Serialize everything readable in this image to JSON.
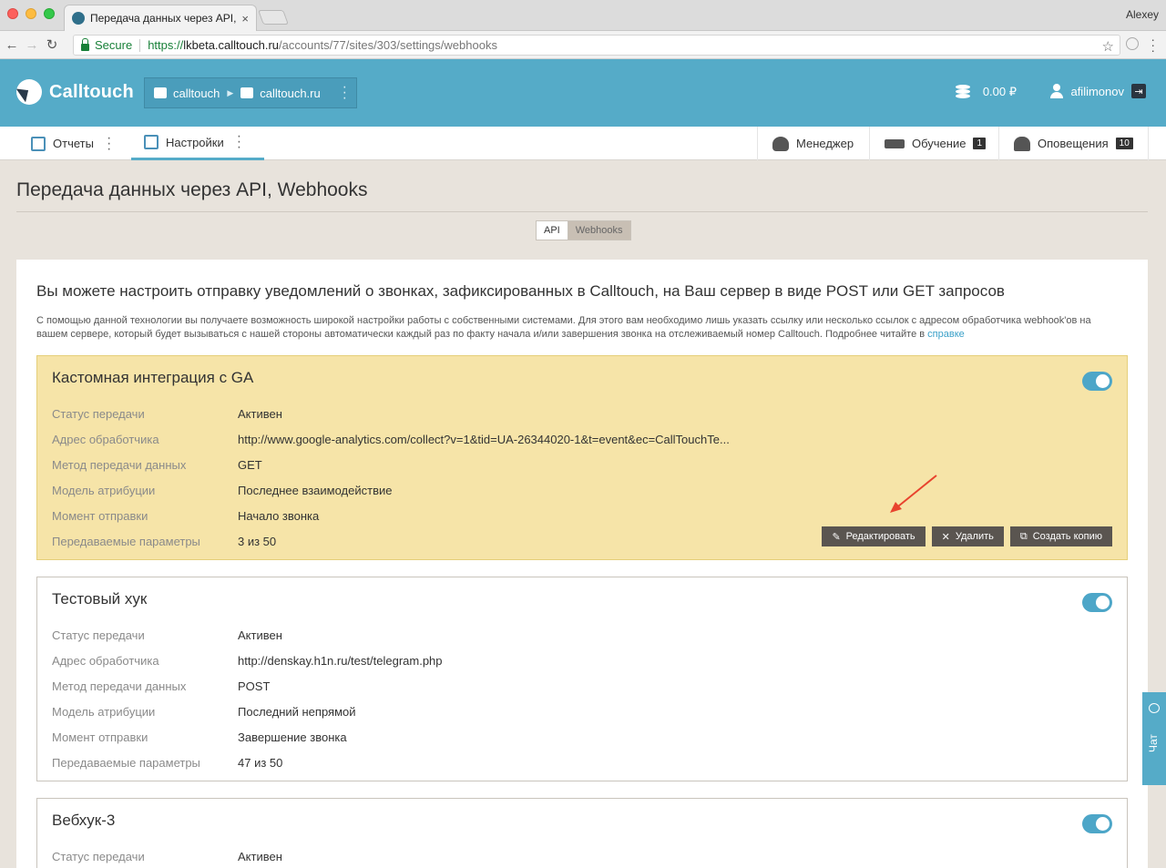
{
  "browser": {
    "tab_title": "Передача данных через API,",
    "tab_close": "×",
    "user_label": "Alexey",
    "secure_label": "Secure",
    "url_scheme": "https://",
    "url_host": "lkbeta.calltouch.ru",
    "url_path": "/accounts/77/sites/303/settings/webhooks",
    "back": "←",
    "forward": "→",
    "reload": "↻",
    "star": "☆"
  },
  "header": {
    "brand": "Calltouch",
    "crumb_account": "calltouch",
    "crumb_site": "calltouch.ru",
    "crumb_arrow": "▶",
    "balance": "0.00 ₽",
    "username": "afilimonov",
    "logout_glyph": "⇥"
  },
  "nav": {
    "reports": "Отчеты",
    "settings": "Настройки",
    "manager": "Менеджер",
    "training": "Обучение",
    "training_badge": "1",
    "notifications": "Оповещения",
    "notifications_badge": "10",
    "kebab": "⋮"
  },
  "page": {
    "title": "Передача данных через API, Webhooks",
    "tab_api": "API",
    "tab_webhooks": "Webhooks",
    "lead": "Вы можете настроить отправку уведомлений о звонках, зафиксированных в Calltouch, на Ваш сервер в виде POST или GET запросов",
    "desc": "С помощью данной технологии вы получаете возможность широкой настройки работы с собственными системами. Для этого вам необходимо лишь указать ссылку или несколько ссылок с адресом обработчика webhook'ов на вашем сервере, который будет вызываться с нашей стороны автоматически каждый раз по факту начала и/или завершения звонка на отслеживаемый номер Calltouch. Подробнее читайте в",
    "desc_link": "справке"
  },
  "labels": {
    "status": "Статус передачи",
    "address": "Адрес обработчика",
    "method": "Метод передачи данных",
    "model": "Модель атрибуции",
    "moment": "Момент отправки",
    "params": "Передаваемые параметры"
  },
  "hooks": [
    {
      "title": "Кастомная интеграция с GA",
      "status": "Активен",
      "address": "http://www.google-analytics.com/collect?v=1&tid=UA-26344020-1&t=event&ec=CallTouchTe...",
      "method": "GET",
      "model": "Последнее взаимодействие",
      "moment": "Начало звонка",
      "params": "3 из 50",
      "enabled": true
    },
    {
      "title": "Тестовый хук",
      "status": "Активен",
      "address": "http://denskay.h1n.ru/test/telegram.php",
      "method": "POST",
      "model": "Последний непрямой",
      "moment": "Завершение звонка",
      "params": "47 из 50",
      "enabled": true
    },
    {
      "title": "Вебхук-3",
      "status": "Активен",
      "enabled": true
    }
  ],
  "actions": {
    "edit": "Редактировать",
    "edit_glyph": "✎",
    "delete": "Удалить",
    "delete_glyph": "✕",
    "copy": "Создать копию",
    "copy_glyph": "⧉"
  },
  "chat": {
    "label": "Чат"
  },
  "colors": {
    "brand": "#55abc8",
    "highlight_card": "#f6e4a8",
    "annotation_arrow": "#e8432e"
  }
}
